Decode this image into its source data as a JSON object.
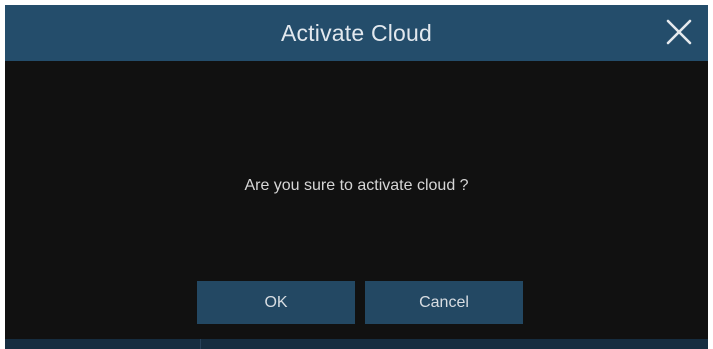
{
  "dialog": {
    "title": "Activate Cloud",
    "message": "Are you sure to activate cloud ?",
    "ok_label": "OK",
    "cancel_label": "Cancel",
    "close_icon": "close-icon"
  },
  "colors": {
    "titlebar": "#244d6b",
    "body": "#111111",
    "button": "#234863",
    "text": "#d6d6d6"
  }
}
